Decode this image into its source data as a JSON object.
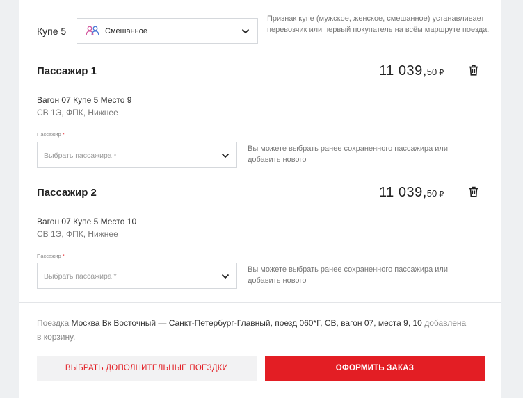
{
  "coupe": {
    "label": "Купе 5",
    "gender_value": "Смешанное",
    "gender_icon": "people-mixed-icon",
    "note": "Признак купе (мужское, женское, смешанное) устанавливает перевозчик или первый покупатель на всём маршруте поезда."
  },
  "passengers": [
    {
      "title": "Пассажир 1",
      "price_main": "11 039,",
      "price_kop": "50",
      "currency": "₽",
      "seat": "Вагон 07 Купе 5 Место 9",
      "car": "СВ 1Э, ФПК, Нижнее",
      "field_label": "Пассажир",
      "required_mark": "*",
      "select_placeholder": "Выбрать пассажира *",
      "hint": "Вы можете выбрать ранее сохраненного пассажира или добавить нового"
    },
    {
      "title": "Пассажир 2",
      "price_main": "11 039,",
      "price_kop": "50",
      "currency": "₽",
      "seat": "Вагон 07 Купе 5 Место 10",
      "car": "СВ 1Э, ФПК, Нижнее",
      "field_label": "Пассажир",
      "required_mark": "*",
      "select_placeholder": "Выбрать пассажира *",
      "hint": "Вы можете выбрать ранее сохраненного пассажира или добавить нового"
    }
  ],
  "summary": {
    "prefix": "Поездка",
    "trip": "Москва Вк Восточный — Санкт-Петербург-Главный, поезд 060*Г, СВ, вагон 07, места 9, 10",
    "suffix": "добавлена в корзину."
  },
  "buttons": {
    "more_trips": "ВЫБРАТЬ ДОПОЛНИТЕЛЬНЫЕ ПОЕЗДКИ",
    "checkout": "ОФОРМИТЬ ЗАКАЗ"
  },
  "colors": {
    "accent": "#e31e24",
    "gender_icon_a": "#d3589e",
    "gender_icon_b": "#4a78d6"
  }
}
